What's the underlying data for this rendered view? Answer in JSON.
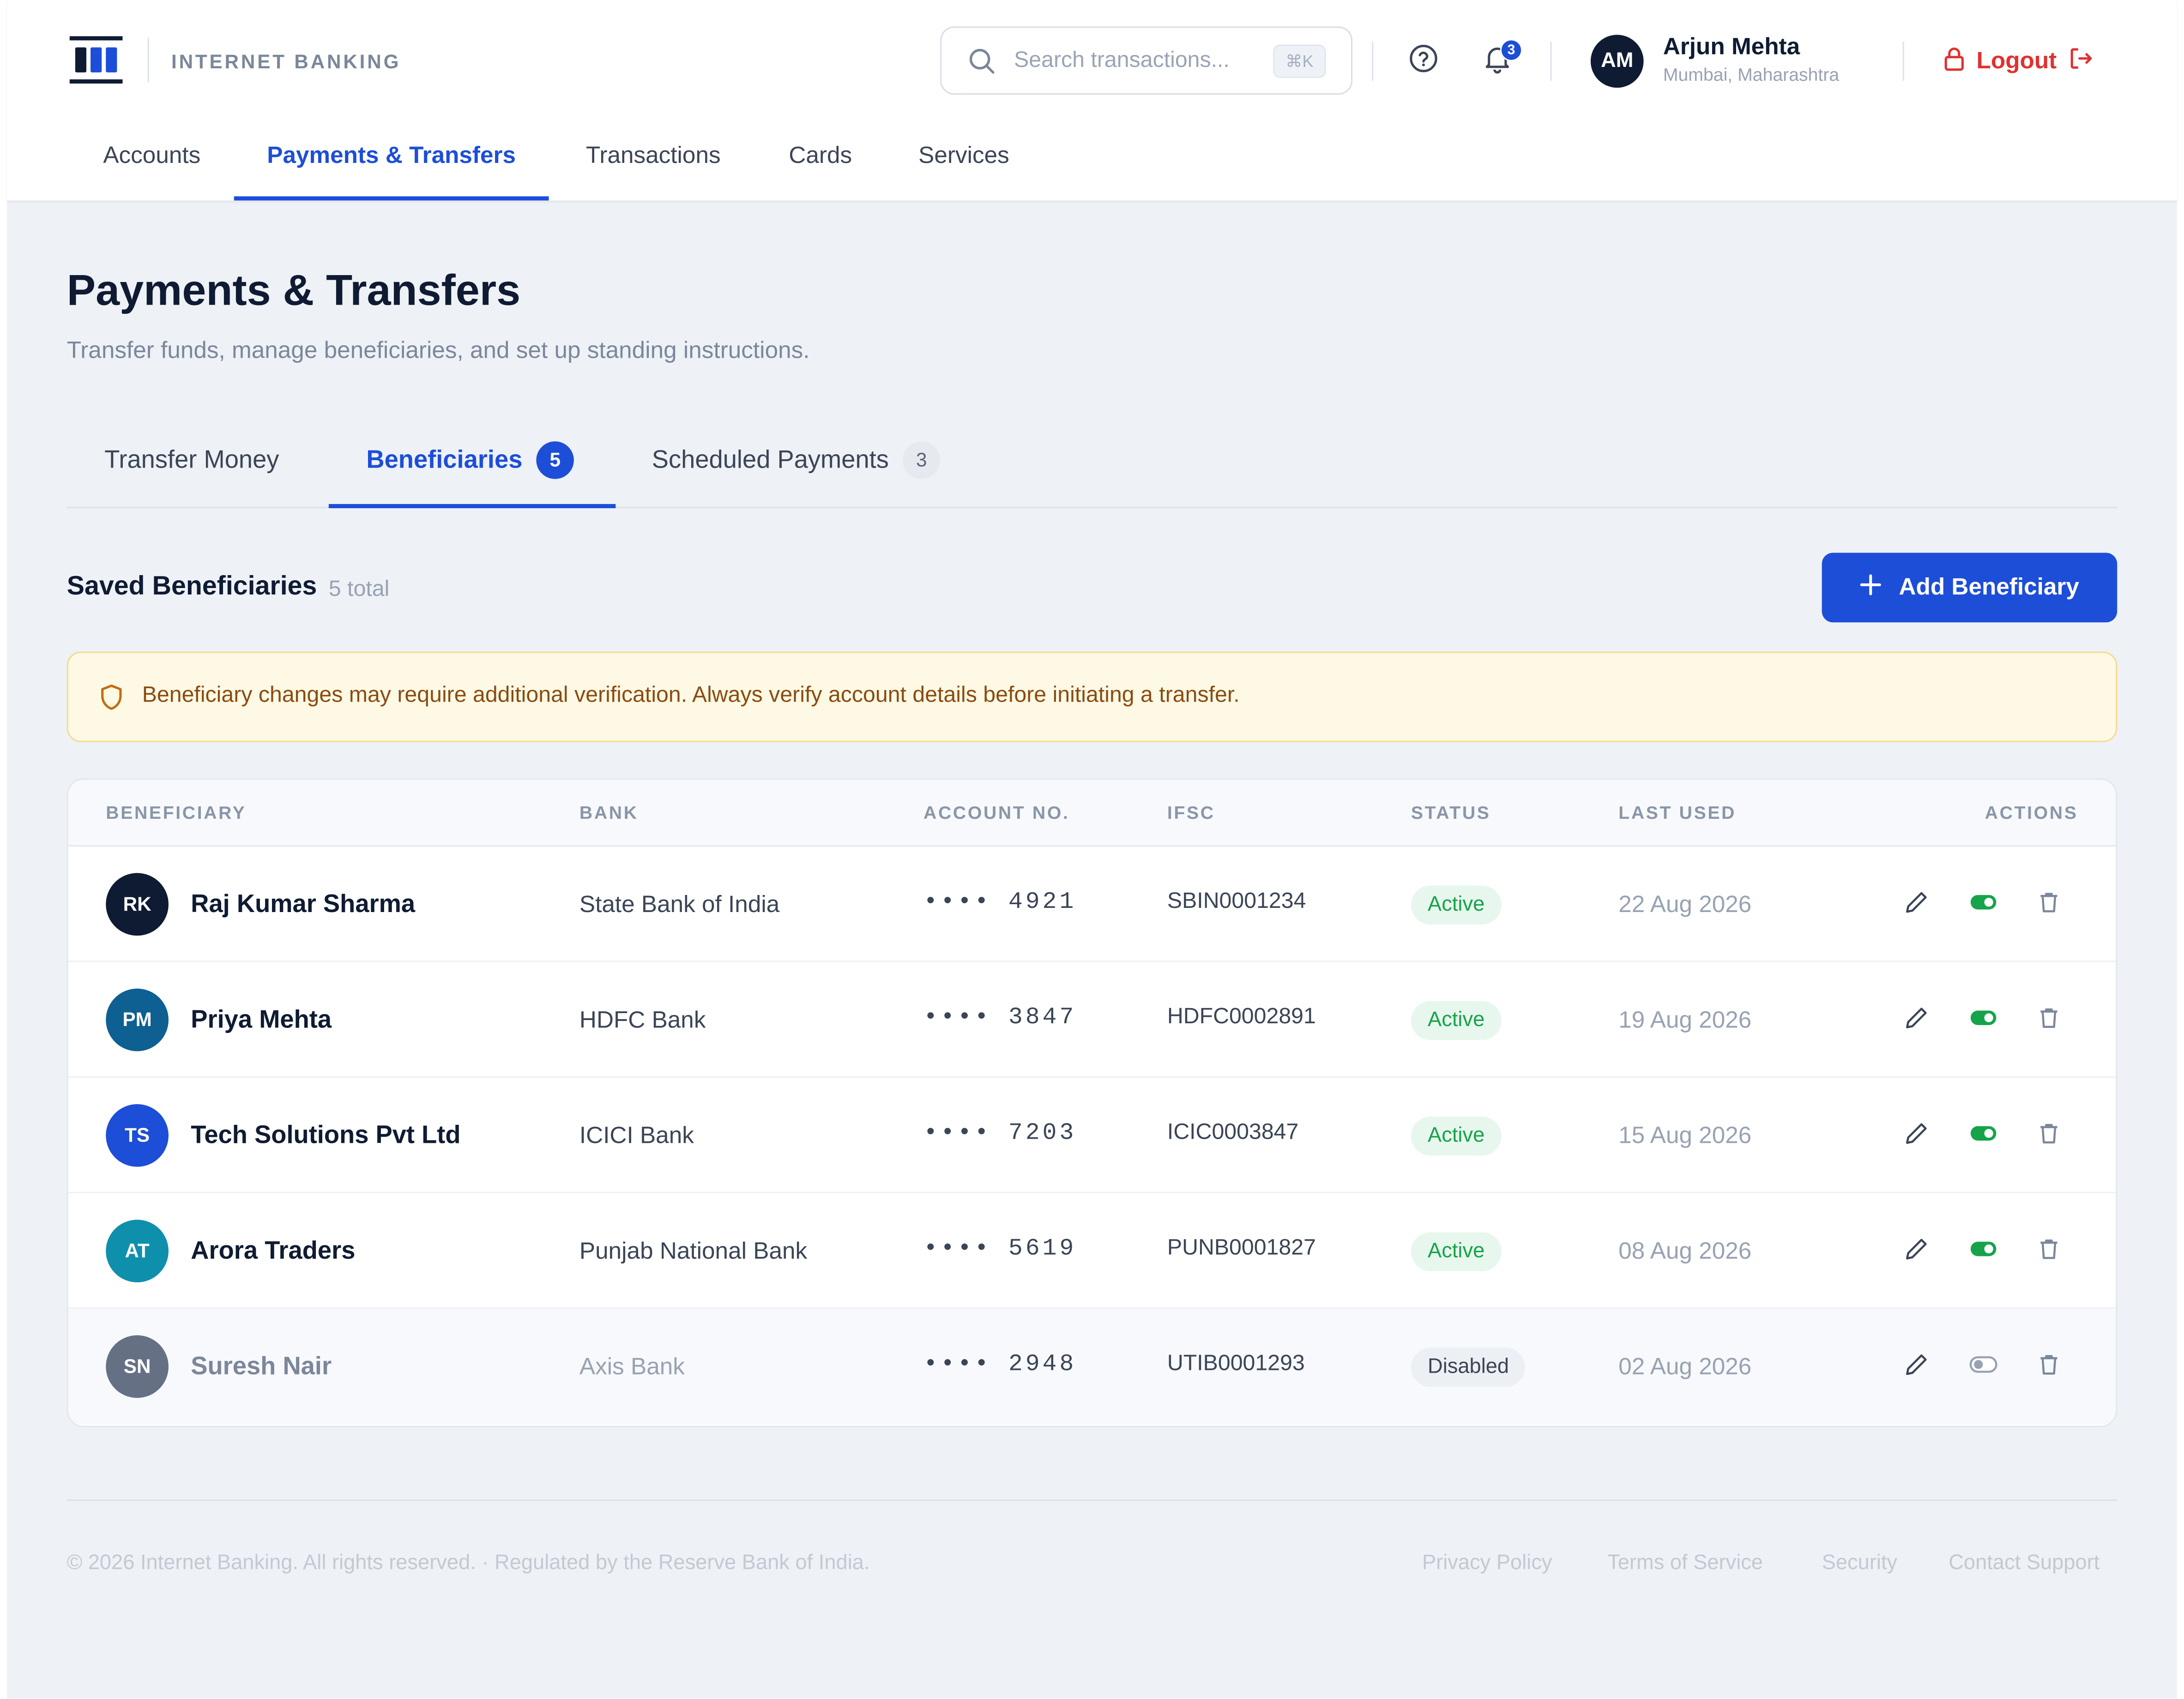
{
  "brand": {
    "name": "INTERNET BANKING"
  },
  "search": {
    "placeholder": "Search transactions...",
    "shortcut": "⌘K"
  },
  "notifications": {
    "count": "3"
  },
  "user": {
    "initials": "AM",
    "name": "Arjun Mehta",
    "location": "Mumbai, Maharashtra"
  },
  "logout": {
    "label": "Logout"
  },
  "nav": {
    "items": [
      {
        "label": "Accounts"
      },
      {
        "label": "Payments & Transfers",
        "active": true
      },
      {
        "label": "Transactions"
      },
      {
        "label": "Cards"
      },
      {
        "label": "Services"
      }
    ]
  },
  "page": {
    "title": "Payments & Transfers",
    "subtitle": "Transfer funds, manage beneficiaries, and set up standing instructions."
  },
  "tabs": [
    {
      "label": "Transfer Money"
    },
    {
      "label": "Beneficiaries",
      "badge": "5",
      "active": true
    },
    {
      "label": "Scheduled Payments",
      "count": "3"
    }
  ],
  "section": {
    "title": "Saved Beneficiaries",
    "count": "5 total"
  },
  "add_button": {
    "label": "Add Beneficiary"
  },
  "alert": {
    "text": "Beneficiary changes may require additional verification. Always verify account details before initiating a transfer."
  },
  "table": {
    "headers": {
      "beneficiary": "BENEFICIARY",
      "bank": "BANK",
      "account": "ACCOUNT NO.",
      "ifsc": "IFSC",
      "status": "STATUS",
      "last_used": "LAST USED",
      "actions": "ACTIONS"
    },
    "rows": [
      {
        "initials": "RK",
        "avatar_color": "#0f1b33",
        "name": "Raj Kumar Sharma",
        "bank": "State Bank of India",
        "account": "•••• 4921",
        "ifsc": "SBIN0001234",
        "status": "Active",
        "last_used": "22 Aug 2026",
        "enabled": true
      },
      {
        "initials": "PM",
        "avatar_color": "#0e5f92",
        "name": "Priya Mehta",
        "bank": "HDFC Bank",
        "account": "•••• 3847",
        "ifsc": "HDFC0002891",
        "status": "Active",
        "last_used": "19 Aug 2026",
        "enabled": true
      },
      {
        "initials": "TS",
        "avatar_color": "#1d4ed8",
        "name": "Tech Solutions Pvt Ltd",
        "bank": "ICICI Bank",
        "account": "•••• 7203",
        "ifsc": "ICIC0003847",
        "status": "Active",
        "last_used": "15 Aug 2026",
        "enabled": true
      },
      {
        "initials": "AT",
        "avatar_color": "#0e90ad",
        "name": "Arora Traders",
        "bank": "Punjab National Bank",
        "account": "•••• 5619",
        "ifsc": "PUNB0001827",
        "status": "Active",
        "last_used": "08 Aug 2026",
        "enabled": true
      },
      {
        "initials": "SN",
        "avatar_color": "#667085",
        "name": "Suresh Nair",
        "bank": "Axis Bank",
        "account": "•••• 2948",
        "ifsc": "UTIB0001293",
        "status": "Disabled",
        "last_used": "02 Aug 2026",
        "enabled": false
      }
    ]
  },
  "colors": {
    "accent": "#1d4ed8",
    "success": "#16a34a",
    "danger": "#e03131",
    "warning_text": "#8a4b12"
  },
  "footer": {
    "copyright": "© 2026 Internet Banking. All rights reserved. · Regulated by the Reserve Bank of India.",
    "links": [
      {
        "label": "Privacy Policy"
      },
      {
        "label": "Terms of Service"
      },
      {
        "label": "Security"
      },
      {
        "label": "Contact Support"
      }
    ]
  }
}
